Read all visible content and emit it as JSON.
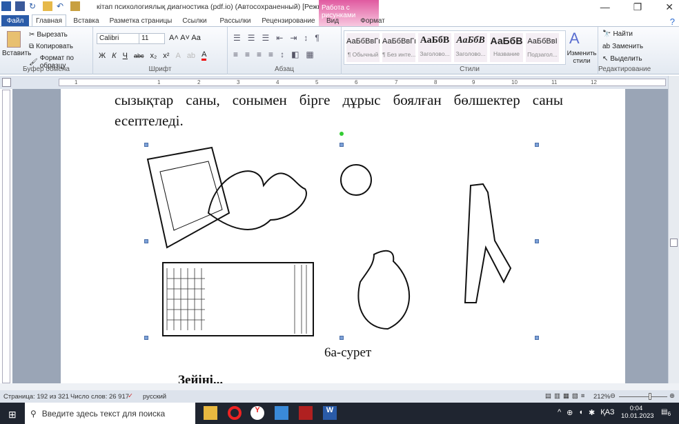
{
  "window": {
    "title": "кітап психологиялық диагностика (pdf.io) (Автосохраненный) [Режим огранич...",
    "context_tab_group": "Работа с рисунками"
  },
  "tabs": [
    "Файл",
    "Главная",
    "Вставка",
    "Разметка страницы",
    "Ссылки",
    "Рассылки",
    "Рецензирование",
    "Вид",
    "Формат"
  ],
  "clipboard": {
    "paste": "Вставить",
    "cut": "Вырезать",
    "copy": "Копировать",
    "format_painter": "Формат по образцу",
    "label": "Буфер обмена"
  },
  "font": {
    "name": "Calibri",
    "size": "11",
    "label": "Шрифт",
    "buttons": [
      "Ж",
      "К",
      "Ч",
      "abc",
      "x₂",
      "x²"
    ]
  },
  "paragraph": {
    "label": "Абзац"
  },
  "styles": {
    "label": "Стили",
    "items": [
      {
        "preview": "АаБбВвГг,",
        "name": "¶ Обычный"
      },
      {
        "preview": "АаБбВвГг,",
        "name": "¶ Без инте..."
      },
      {
        "preview": "АаБбВ",
        "name": "Заголово..."
      },
      {
        "preview": "АаБбВ",
        "name": "Заголово..."
      },
      {
        "preview": "АаБбВ",
        "name": "Название"
      },
      {
        "preview": "АаБбВвІ",
        "name": "Подзагол..."
      }
    ],
    "change": "Изменить стили"
  },
  "editing": {
    "label": "Редактирование",
    "find": "Найти",
    "replace": "Заменить",
    "select": "Выделить"
  },
  "ruler_numbers": [
    "1",
    "2",
    "1",
    "2",
    "3",
    "4",
    "5",
    "6",
    "7",
    "8",
    "9",
    "10",
    "11",
    "12"
  ],
  "document": {
    "line1": "сызықтар саны, сонымен бірге дұрыс боялған бөлшектер саны",
    "line2": "есептеледі.",
    "caption": "6а-сурет",
    "line3": "Зейіні..."
  },
  "status": {
    "page": "Страница: 192 из 321",
    "words": "Число слов: 26 917",
    "language": "русский",
    "zoom": "212%"
  },
  "taskbar": {
    "search_placeholder": "Введите здесь текст для поиска",
    "lang": "ҚАЗ",
    "time": "0:04",
    "date": "10.01.2023",
    "notifications": "6"
  }
}
